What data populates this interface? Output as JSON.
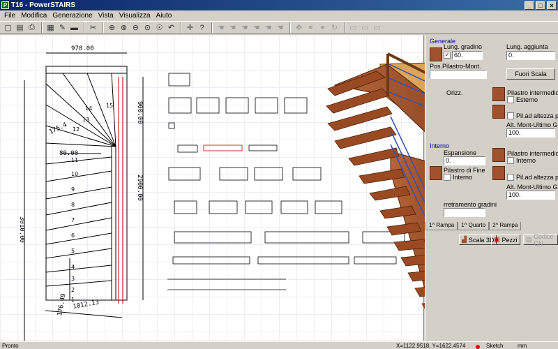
{
  "window": {
    "title": "T16 - PowerSTAIRS",
    "icon_letter": "P"
  },
  "menu": [
    "File",
    "Modifica",
    "Generazione",
    "Vista",
    "Visualizza",
    "Aiuto"
  ],
  "toolbar_icons": [
    "new-icon",
    "open-icon",
    "print-icon",
    "save-icon",
    "pencil-icon",
    "tape-icon",
    "cut-icon",
    "zoom-in-icon",
    "zoom-out-icon",
    "zoom-minus-icon",
    "zoom-window-icon",
    "pan-icon",
    "back-icon",
    "query-icon",
    "hand-icon",
    "hand-icon",
    "hand-icon",
    "hand-icon",
    "hand-icon",
    "cross-move-icon",
    "link-icon",
    "link2-icon",
    "page-icon",
    "page2-icon",
    "page3-icon"
  ],
  "drawing": {
    "dim_top": "978.00",
    "dim_left": "3010.00",
    "dim_right": "2900.00",
    "dim_inner": "900.00",
    "dim_bottom": "1012.13",
    "dim_bottom2": "176.49",
    "dim_175": "175.4",
    "dim_80": "80.00",
    "step_numbers": [
      "15",
      "14",
      "13",
      "12",
      "11",
      "10",
      "9",
      "8",
      "7",
      "6",
      "5",
      "4",
      "3",
      "2",
      "1"
    ]
  },
  "panel": {
    "generale_label": "Generale",
    "lung_gradino_label": "Lung. gradino",
    "lung_gradino_value": "60.",
    "lung_aggiunta_label": "Lung. aggiunta",
    "lung_aggiunta_value": "0.",
    "pos_pilastro_label": "Pos.Pilastro-Mont.",
    "fuori_scala_button": "Fuori Scala",
    "orizz_label": "Orizz.",
    "pilastro_intermedio_1": "Pilastro intermedio",
    "esterno_label": "Esterno",
    "pil_altezza_1": "Pil.ad altezza piana",
    "alt_mont_1_label": "Alt. Mont-Ultimo Grd",
    "alt_mont_1_value": "100.",
    "interno_group": "Interno",
    "espansione_label": "Espansione",
    "espansione_value": "0.",
    "pilastro_intermedio_2": "Pilastro intermedio",
    "interno_check_label": "Interno",
    "pilastro_di_fine": "Pilastro di Fine",
    "interno_fine_label": "Interno",
    "pil_altezza_2": "Pil.ad altezza piana",
    "alt_mont_2_label": "Alt. Mont-Ultimo Grd",
    "alt_mont_2_value": "100.",
    "arretramento_label": "rretramento gradini",
    "tabs": [
      "1^ Rampa",
      "1^ Quarto",
      "2^ Rampa"
    ],
    "scala3d_button": "Scala 3D",
    "pezzi_button": "Pezzi",
    "codice_button": "Codice CN"
  },
  "status": {
    "ready": "Pronto",
    "coords": "X=1122.9518, Y=1622.4574",
    "mode": "Sketch",
    "units": "mm"
  },
  "colors": {
    "titlebar": "#0a246a",
    "wood": "#a0522d",
    "rail": "#3a4fa8",
    "panel_group": "#0000a8"
  }
}
